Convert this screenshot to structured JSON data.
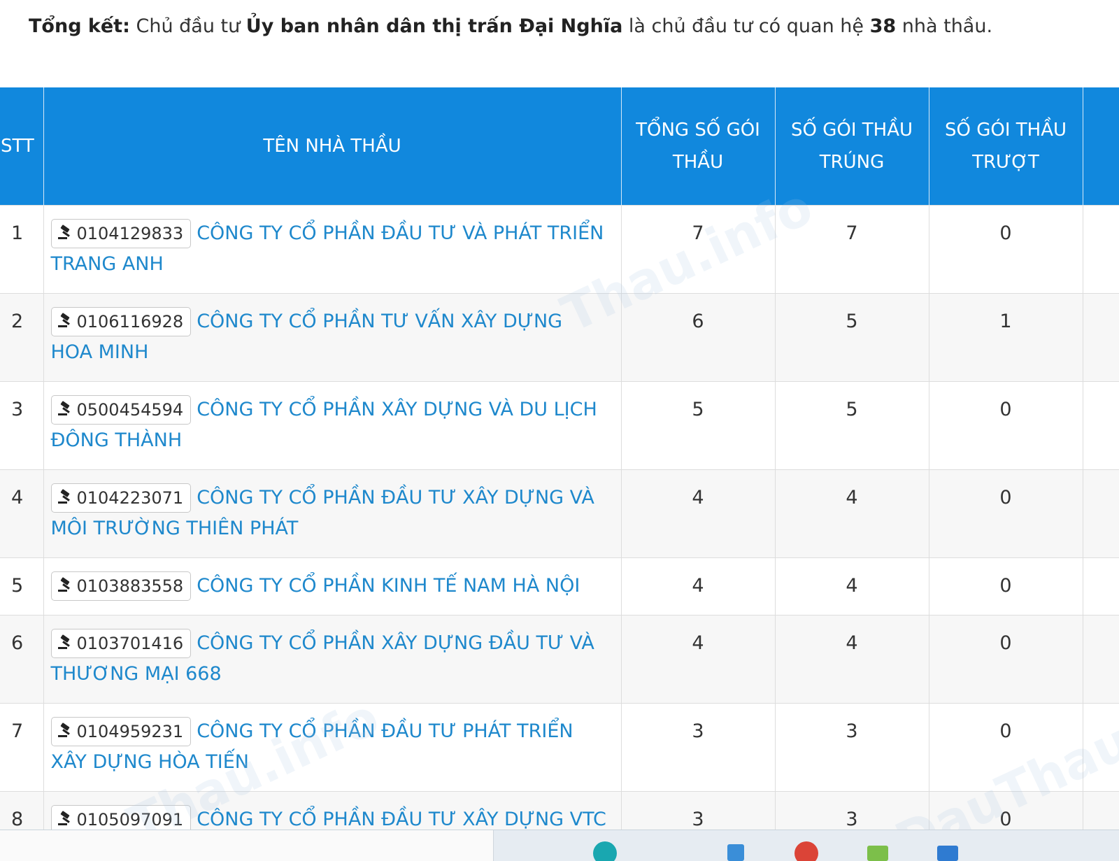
{
  "summary": {
    "label": "Tổng kết:",
    "text1": " Chủ đầu tư ",
    "owner": "Ủy ban nhân dân thị trấn Đại Nghĩa",
    "text2": " là chủ đầu tư có quan hệ ",
    "count": "38",
    "text3": " nhà thầu."
  },
  "table": {
    "headers": {
      "stt": "STT",
      "name": "TÊN NHÀ THẦU",
      "total": "TỔNG SỐ GÓI THẦU",
      "won": "SỐ GÓI THẦU TRÚNG",
      "lost": "SỐ GÓI THẦU TRƯỢT"
    },
    "rows": [
      {
        "stt": "1",
        "tax_id": "0104129833",
        "name": "CÔNG TY CỔ PHẦN ĐẦU TƯ VÀ PHÁT TRIỂN TRANG ANH",
        "total": "7",
        "won": "7",
        "lost": "0"
      },
      {
        "stt": "2",
        "tax_id": "0106116928",
        "name": "CÔNG TY CỔ PHẦN TƯ VẤN XÂY DỰNG HOA MINH",
        "total": "6",
        "won": "5",
        "lost": "1"
      },
      {
        "stt": "3",
        "tax_id": "0500454594",
        "name": "CÔNG TY CỔ PHẦN XÂY DỰNG VÀ DU LỊCH ĐÔNG THÀNH",
        "total": "5",
        "won": "5",
        "lost": "0"
      },
      {
        "stt": "4",
        "tax_id": "0104223071",
        "name": "CÔNG TY CỔ PHẦN ĐẦU TƯ XÂY DỰNG VÀ MÔI TRƯỜNG THIÊN PHÁT",
        "total": "4",
        "won": "4",
        "lost": "0"
      },
      {
        "stt": "5",
        "tax_id": "0103883558",
        "name": "CÔNG TY CỔ PHẦN KINH TẾ NAM HÀ NỘI",
        "total": "4",
        "won": "4",
        "lost": "0"
      },
      {
        "stt": "6",
        "tax_id": "0103701416",
        "name": "CÔNG TY CỔ PHẦN XÂY DỰNG ĐẦU TƯ VÀ THƯƠNG MẠI 668",
        "total": "4",
        "won": "4",
        "lost": "0"
      },
      {
        "stt": "7",
        "tax_id": "0104959231",
        "name": "CÔNG TY CỔ PHẦN ĐẦU TƯ PHÁT TRIỂN XÂY DỰNG HÒA TIẾN",
        "total": "3",
        "won": "3",
        "lost": "0"
      },
      {
        "stt": "8",
        "tax_id": "0105097091",
        "name": "CÔNG TY CỔ PHẦN ĐẦU TƯ XÂY DỰNG VTC",
        "total": "3",
        "won": "3",
        "lost": "0"
      }
    ]
  },
  "icons": {
    "id_badge": "gavel-icon"
  },
  "colors": {
    "header_bg": "#1188dd",
    "link": "#1e88cc",
    "row_alt": "#f7f7f7"
  }
}
